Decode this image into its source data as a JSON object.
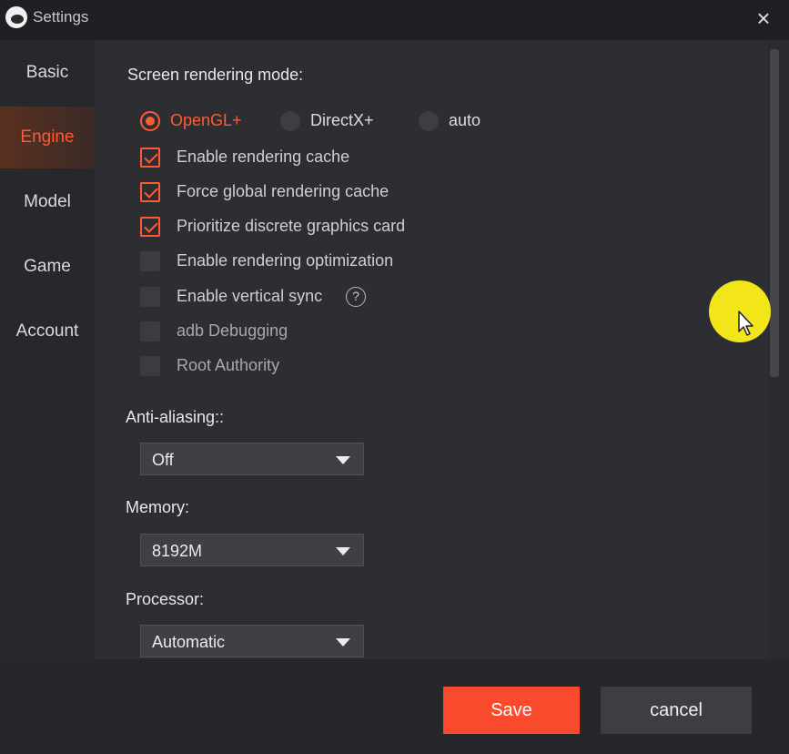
{
  "window": {
    "title": "Settings"
  },
  "sidebar": {
    "items": [
      {
        "label": "Basic"
      },
      {
        "label": "Engine",
        "active": true
      },
      {
        "label": "Model"
      },
      {
        "label": "Game"
      },
      {
        "label": "Account"
      }
    ]
  },
  "engine": {
    "rendering_mode_label": "Screen rendering mode:",
    "rendering_modes": [
      {
        "label": "OpenGL+",
        "selected": true
      },
      {
        "label": "DirectX+",
        "selected": false
      },
      {
        "label": "auto",
        "selected": false
      }
    ],
    "options": [
      {
        "label": "Enable rendering cache",
        "checked": true
      },
      {
        "label": "Force global rendering cache",
        "checked": true
      },
      {
        "label": "Prioritize discrete graphics card",
        "checked": true
      },
      {
        "label": "Enable rendering optimization",
        "checked": false
      },
      {
        "label": "Enable vertical sync",
        "checked": false,
        "help": "?"
      },
      {
        "label": "adb Debugging",
        "checked": false
      },
      {
        "label": "Root Authority",
        "checked": false
      }
    ],
    "anti_aliasing": {
      "label": "Anti-aliasing::",
      "value": "Off"
    },
    "memory": {
      "label": "Memory:",
      "value": "8192M"
    },
    "processor": {
      "label": "Processor:",
      "value": "Automatic"
    }
  },
  "footer": {
    "save_label": "Save",
    "cancel_label": "cancel"
  },
  "colors": {
    "accent": "#ff5a36",
    "save_button": "#fa4a2e",
    "cursor_highlight": "#f2e51a"
  },
  "icons": {
    "close": "close-icon",
    "help": "help-icon",
    "logo": "app-logo-icon"
  }
}
